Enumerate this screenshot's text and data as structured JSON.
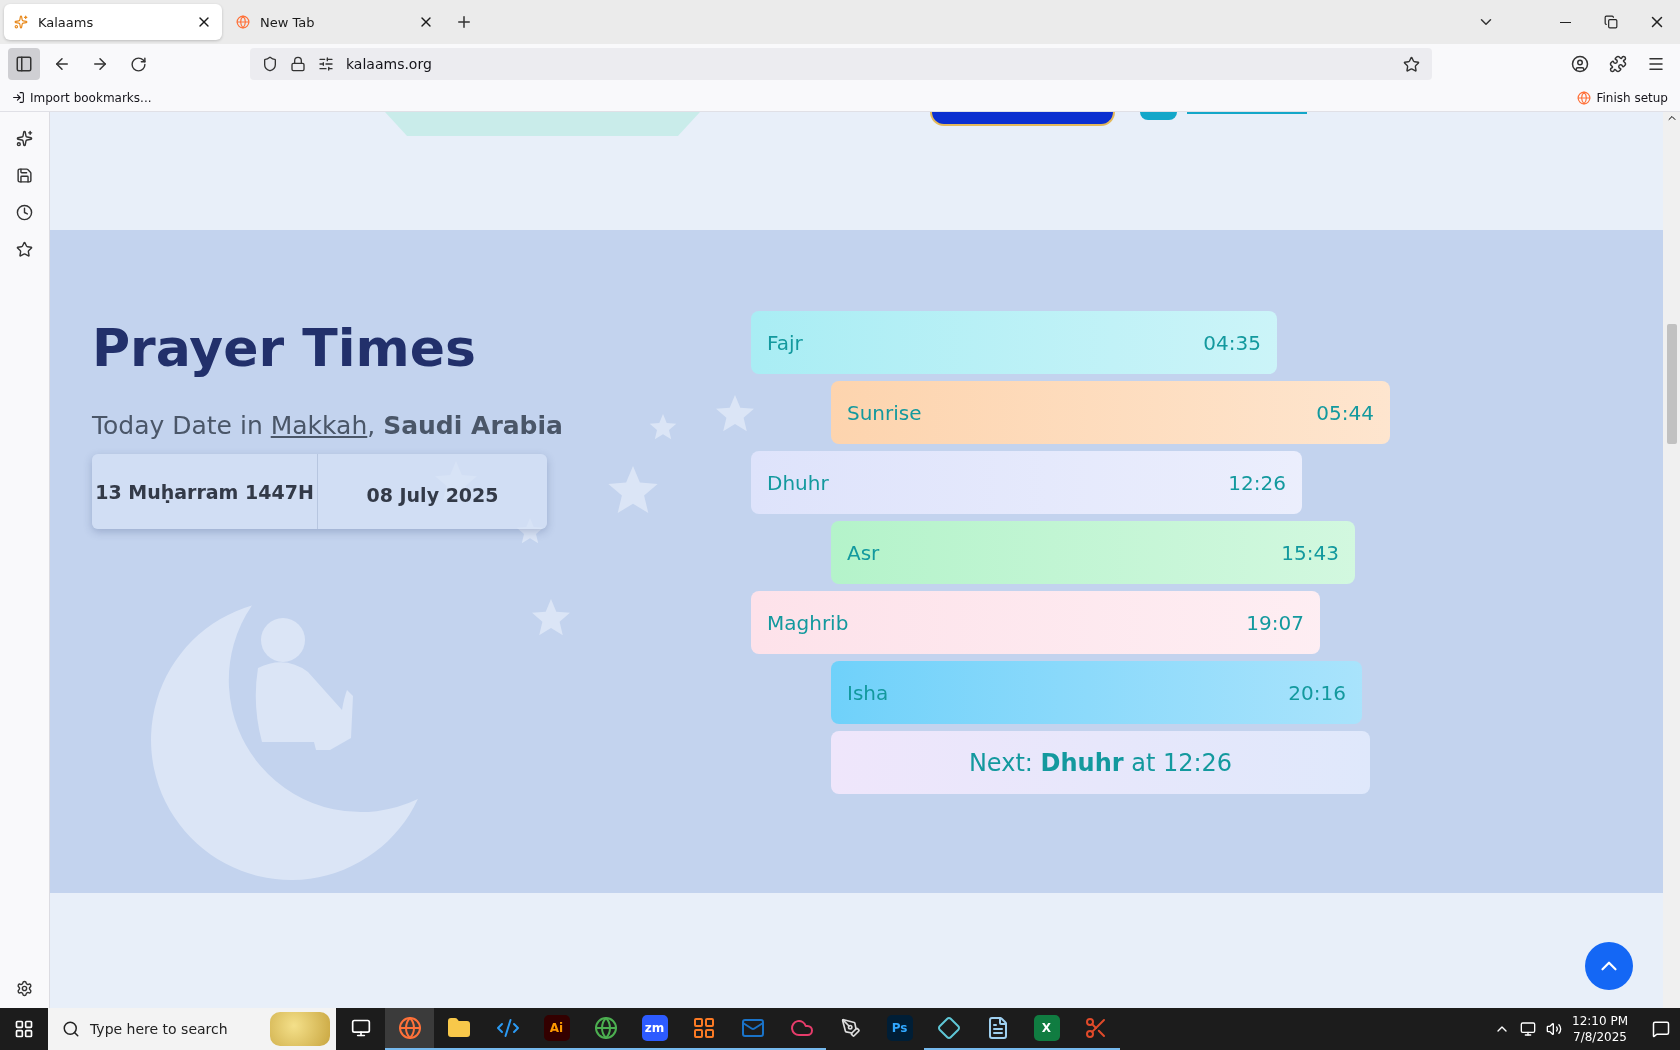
{
  "browser": {
    "tabs": [
      {
        "title": "Kalaams",
        "selected": true
      },
      {
        "title": "New Tab",
        "selected": false
      }
    ],
    "url": "kalaams.org",
    "bookmarks": [
      {
        "label": "Import bookmarks..."
      }
    ],
    "finish_setup": "Finish setup"
  },
  "prayer_section": {
    "title": "Prayer Times",
    "subtitle_prefix": "Today Date in",
    "city": "Makkah",
    "separator": ",",
    "country": "Saudi Arabia",
    "hijri_date": "13 Muḥarram 1447H",
    "gregorian_date": "08 July 2025",
    "prayers": [
      {
        "name": "Fajr",
        "time": "04:35",
        "color": "#a9edf4"
      },
      {
        "name": "Sunrise",
        "time": "05:44",
        "color": "#fdd4ae"
      },
      {
        "name": "Dhuhr",
        "time": "12:26",
        "color": "#dee3fb"
      },
      {
        "name": "Asr",
        "time": "15:43",
        "color": "#b4f3ca"
      },
      {
        "name": "Maghrib",
        "time": "19:07",
        "color": "#fde2ea"
      },
      {
        "name": "Isha",
        "time": "20:16",
        "color": "#6fd1fa"
      }
    ],
    "next": "Next: **Dhuhr** at 12:26"
  },
  "taskbar": {
    "search_placeholder": "Type here to search",
    "apps": [
      {
        "kind": "fox",
        "selected": true,
        "running": true
      },
      {
        "kind": "folder",
        "selected": false,
        "running": true
      },
      {
        "kind": "code",
        "selected": false,
        "running": true
      },
      {
        "kind": "ai",
        "label": "Ai",
        "selected": false,
        "running": true
      },
      {
        "kind": "globe",
        "selected": false,
        "running": true
      },
      {
        "kind": "zm",
        "label": "zm",
        "selected": false,
        "running": true
      },
      {
        "kind": "xampp",
        "selected": false,
        "running": true
      },
      {
        "kind": "mail",
        "selected": false,
        "running": true
      },
      {
        "kind": "cloud",
        "selected": false,
        "running": true
      },
      {
        "kind": "pen",
        "selected": false,
        "running": false
      },
      {
        "kind": "ps",
        "label": "Ps",
        "selected": false,
        "running": false
      },
      {
        "kind": "gem",
        "selected": false,
        "running": true
      },
      {
        "kind": "notepad",
        "selected": false,
        "running": true
      },
      {
        "kind": "sheet",
        "label": "X",
        "selected": false,
        "running": true
      },
      {
        "kind": "scissors",
        "selected": false,
        "running": true
      }
    ],
    "time": "12:10 PM",
    "date": "7/8/2025"
  }
}
